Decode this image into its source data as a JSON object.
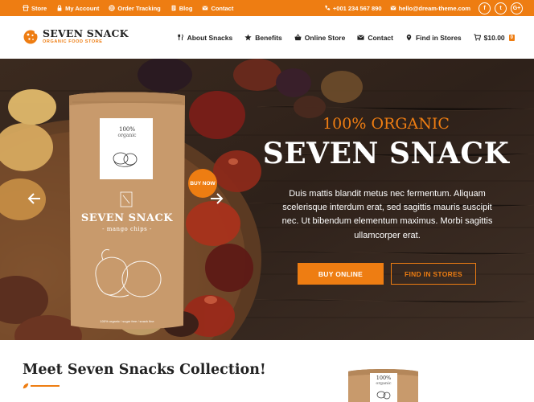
{
  "topbar": {
    "links": [
      {
        "label": "Store",
        "icon": "shop-icon"
      },
      {
        "label": "My Account",
        "icon": "lock-icon"
      },
      {
        "label": "Order Tracking",
        "icon": "globe-icon"
      },
      {
        "label": "Blog",
        "icon": "document-icon"
      },
      {
        "label": "Contact",
        "icon": "envelope-icon"
      }
    ],
    "phone": "+001 234 567 890",
    "email": "hello@dream-theme.com",
    "social": [
      "f",
      "t",
      "G+"
    ]
  },
  "header": {
    "logo_title": "SEVEN SNACK",
    "logo_subtitle": "ORGANIC FOOD STORE",
    "nav": [
      {
        "label": "About Snacks",
        "icon": "utensils-icon"
      },
      {
        "label": "Benefits",
        "icon": "star-icon"
      },
      {
        "label": "Online Store",
        "icon": "basket-icon"
      },
      {
        "label": "Contact",
        "icon": "envelope-icon"
      },
      {
        "label": "Find in Stores",
        "icon": "map-pin-icon"
      }
    ],
    "cart_total": "$10.00",
    "cart_count": "0"
  },
  "hero": {
    "pretitle": "100% ORGANIC",
    "title": "SEVEN SNACK",
    "text": "Duis mattis blandit metus nec fermentum. Aliquam scelerisque interdum erat, sed sagittis mauris suscipit nec. Ut bibendum elementum maximus. Morbi sagittis ullamcorper erat.",
    "primary_button": "BUY ONLINE",
    "secondary_button": "FIND IN STORES",
    "badge": "BUY NOW",
    "bag": {
      "percent": "100%",
      "organic": "organic",
      "name": "SEVEN SNACK",
      "flavor": "- mango chips -",
      "footer": "100% organic / sugar free / snack fine"
    }
  },
  "section": {
    "title": "Meet Seven Snacks Collection!",
    "mini_percent": "100%",
    "mini_organic": "organic"
  },
  "colors": {
    "accent": "#ee7d12",
    "kraft": "#c89a6c",
    "wood": "#3a2a20"
  }
}
